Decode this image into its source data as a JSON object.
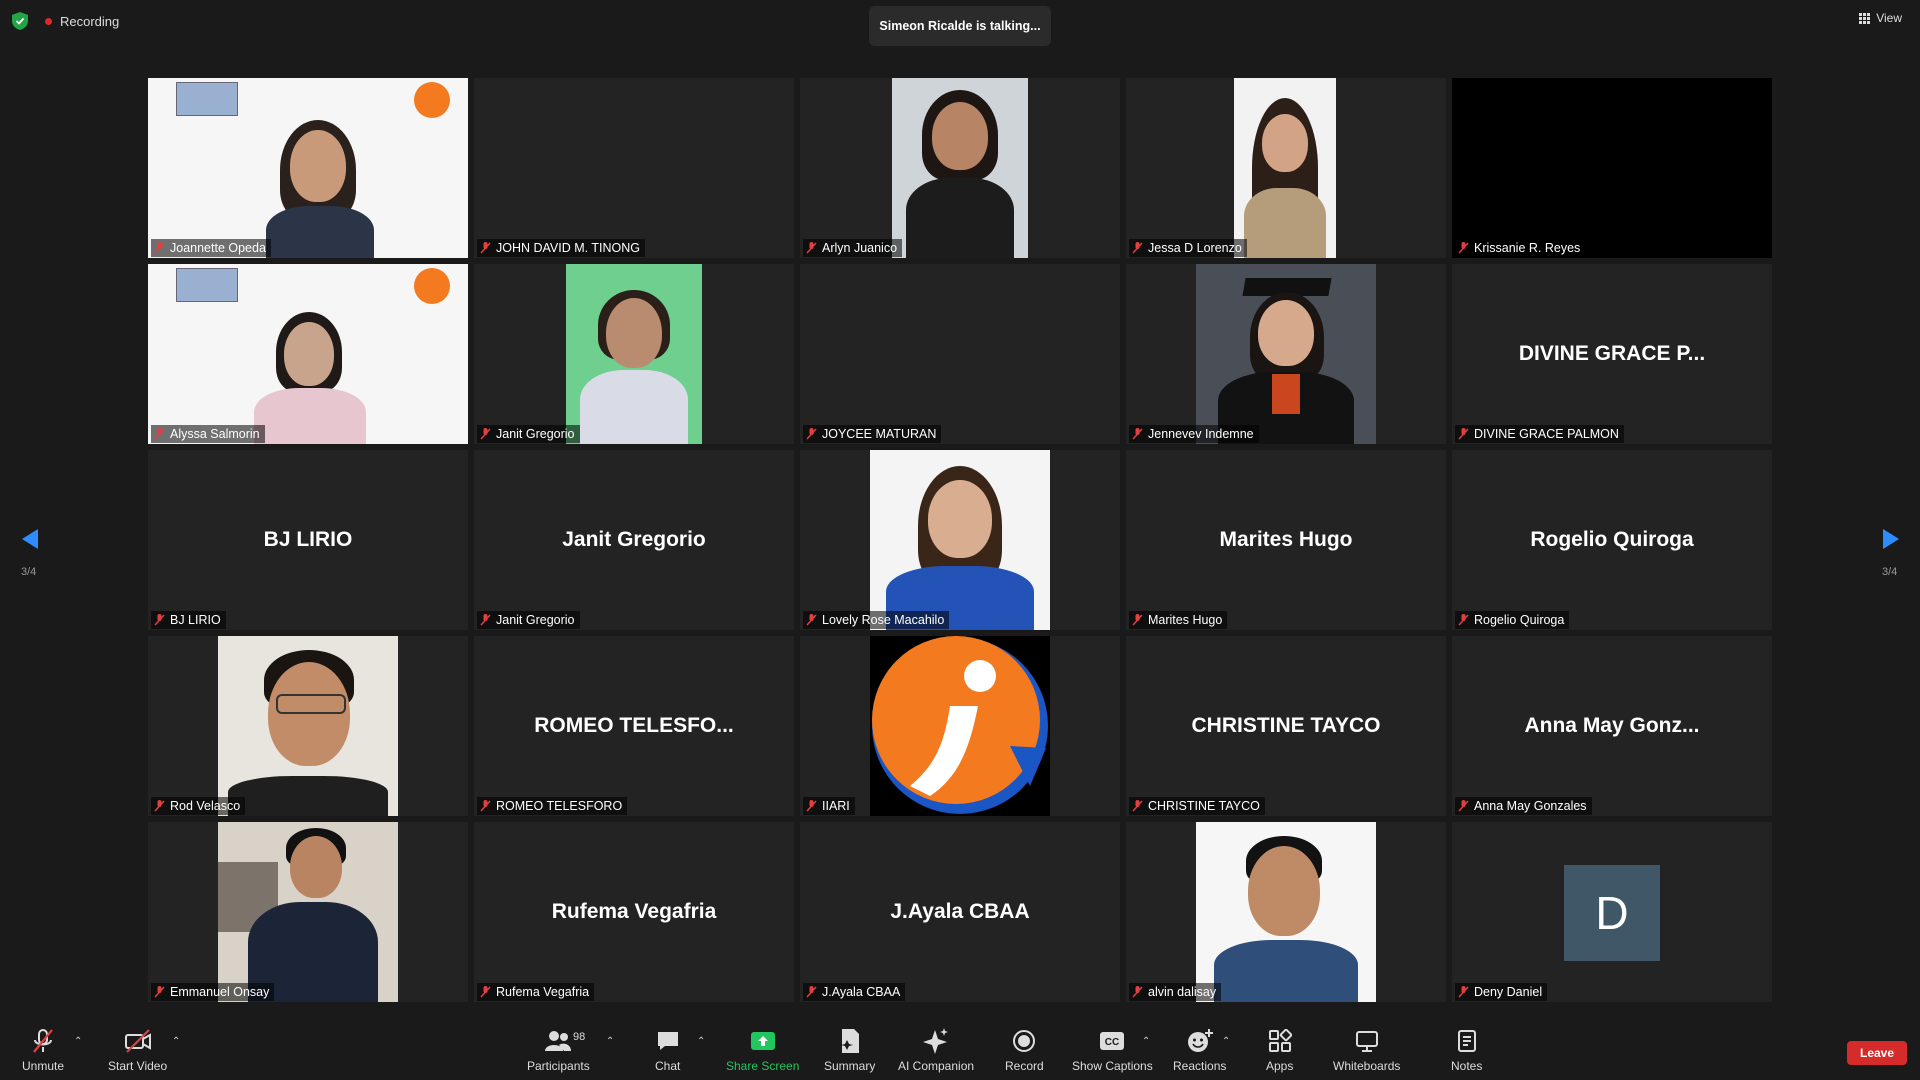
{
  "topbar": {
    "recording_label": "Recording",
    "talking_text": "Simeon Ricalde is talking...",
    "view_label": "View"
  },
  "tiles": [
    {
      "name": "Joannette Opeda",
      "big": ""
    },
    {
      "name": "JOHN DAVID M. TINONG",
      "big": ""
    },
    {
      "name": "Arlyn Juanico",
      "big": ""
    },
    {
      "name": "Jessa D Lorenzo",
      "big": ""
    },
    {
      "name": "Krissanie R. Reyes",
      "big": ""
    },
    {
      "name": "Alyssa Salmorin",
      "big": ""
    },
    {
      "name": "Janit Gregorio",
      "big": ""
    },
    {
      "name": "JOYCEE MATURAN",
      "big": ""
    },
    {
      "name": "Jennevev Indemne",
      "big": ""
    },
    {
      "name": "DIVINE GRACE PALMON",
      "big": "DIVINE GRACE P..."
    },
    {
      "name": "BJ LIRIO",
      "big": "BJ LIRIO"
    },
    {
      "name": "Janit Gregorio",
      "big": "Janit Gregorio"
    },
    {
      "name": "Lovely Rose Macahilo",
      "big": ""
    },
    {
      "name": "Marites Hugo",
      "big": "Marites Hugo"
    },
    {
      "name": "Rogelio Quiroga",
      "big": "Rogelio Quiroga"
    },
    {
      "name": "Rod Velasco",
      "big": ""
    },
    {
      "name": "ROMEO TELESFORO",
      "big": "ROMEO  TELESFO..."
    },
    {
      "name": "IIARI",
      "big": ""
    },
    {
      "name": "CHRISTINE TAYCO",
      "big": "CHRISTINE TAYCO"
    },
    {
      "name": "Anna May Gonzales",
      "big": "Anna  May  Gonz..."
    },
    {
      "name": "Emmanuel Onsay",
      "big": ""
    },
    {
      "name": "Rufema Vegafria",
      "big": "Rufema Vegafria"
    },
    {
      "name": "J.Ayala CBAA",
      "big": "J.Ayala CBAA"
    },
    {
      "name": "alvin dalisay",
      "big": ""
    },
    {
      "name": "Deny Daniel",
      "big": "",
      "avatar_letter": "D"
    }
  ],
  "pagination": {
    "left": "3/4",
    "right": "3/4"
  },
  "toolbar": {
    "unmute": "Unmute",
    "start_video": "Start Video",
    "participants": "Participants",
    "participants_count": "98",
    "chat": "Chat",
    "share_screen": "Share Screen",
    "summary": "Summary",
    "ai_companion": "AI Companion",
    "record": "Record",
    "show_captions": "Show Captions",
    "reactions": "Reactions",
    "apps": "Apps",
    "whiteboards": "Whiteboards",
    "notes": "Notes",
    "leave": "Leave"
  },
  "colors": {
    "leave": "#d52b2b",
    "share_screen": "#22c55e",
    "recording_dot": "#e02828",
    "avatar_bg": "#3f5766"
  }
}
